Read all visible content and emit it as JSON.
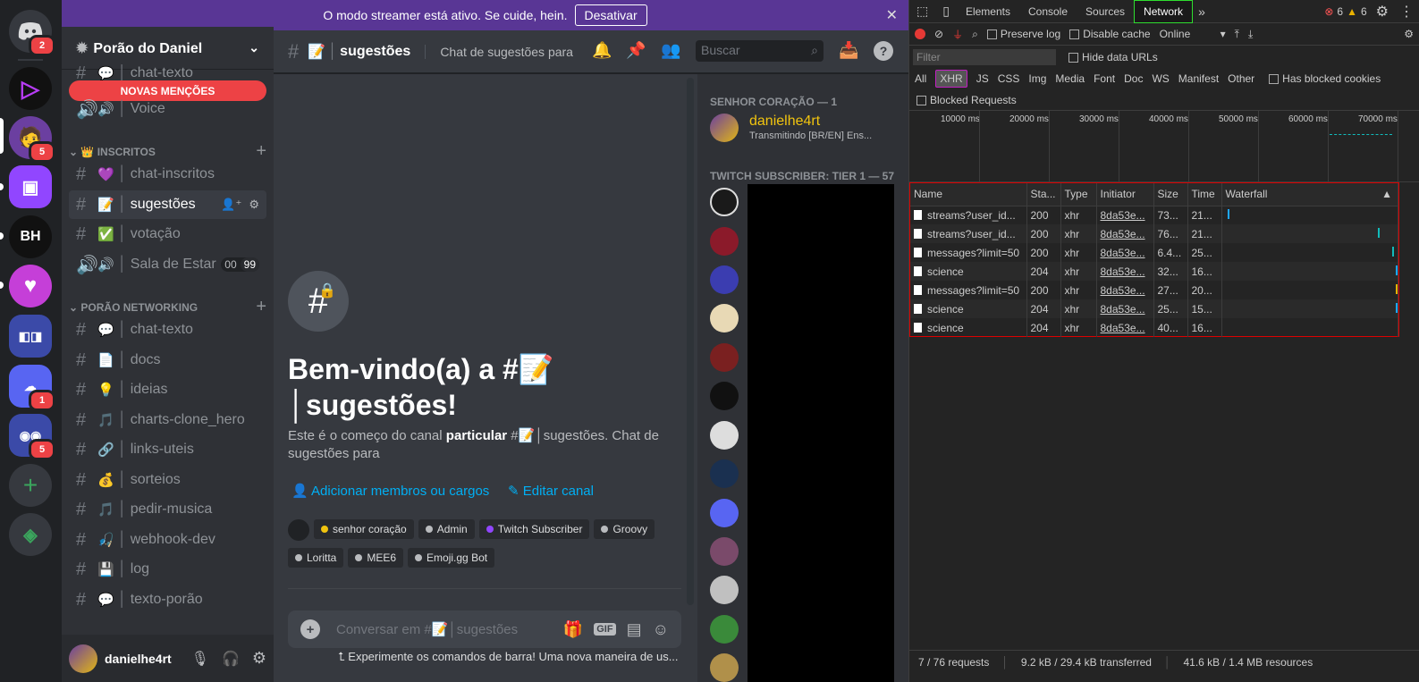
{
  "banner": {
    "text": "O modo streamer está ativo. Se cuide, hein.",
    "button": "Desativar"
  },
  "rail": {
    "badges": [
      "2",
      "5",
      "1",
      "5"
    ],
    "server_initials": "BH"
  },
  "server": {
    "name": "Porão do Daniel",
    "new_mentions": "NOVAS MENÇÕES"
  },
  "channels_top": [
    {
      "name": "chat-texto",
      "emoji": "💬",
      "type": "text"
    },
    {
      "name": "Voice",
      "emoji": "🔊",
      "type": "voice"
    }
  ],
  "category1": {
    "icon": "👑",
    "name": "INSCRITOS"
  },
  "channels_cat1": [
    {
      "emoji": "💜",
      "name": "chat-inscritos",
      "type": "text"
    },
    {
      "emoji": "📝",
      "name": "sugestões",
      "type": "text"
    },
    {
      "emoji": "✅",
      "name": "votação",
      "type": "text"
    },
    {
      "emoji": "🔊",
      "name": "Sala de Estar",
      "type": "voice",
      "count1": "00",
      "count2": "99"
    }
  ],
  "category2": {
    "name": "PORÃO NETWORKING"
  },
  "channels_cat2": [
    {
      "emoji": "💬",
      "name": "chat-texto"
    },
    {
      "emoji": "📄",
      "name": "docs"
    },
    {
      "emoji": "💡",
      "name": "ideias"
    },
    {
      "emoji": "🎵",
      "name": "charts-clone_hero"
    },
    {
      "emoji": "🔗",
      "name": "links-uteis"
    },
    {
      "emoji": "💰",
      "name": "sorteios"
    },
    {
      "emoji": "🎵",
      "name": "pedir-musica"
    },
    {
      "emoji": "🎣",
      "name": "webhook-dev"
    },
    {
      "emoji": "💾",
      "name": "log"
    },
    {
      "emoji": "💬",
      "name": "texto-porão"
    }
  ],
  "user": {
    "name": "danielhe4rt"
  },
  "header": {
    "emoji": "📝",
    "channel": "sugestões",
    "topic": "Chat de sugestões para",
    "search_placeholder": "Buscar"
  },
  "welcome": {
    "title_a": "Bem-vindo(a) a #📝",
    "title_b": "│sugestões!",
    "desc_a": "Este é o começo do canal ",
    "desc_bold": "particular",
    "desc_b": " #📝│sugestões. Chat de sugestões para",
    "add_members": "Adicionar membros ou cargos",
    "edit_channel": "Editar canal"
  },
  "roles": [
    {
      "name": "senhor coração",
      "color": "#f1c40f"
    },
    {
      "name": "Admin",
      "color": "#b9bbbe"
    },
    {
      "name": "Twitch Subscriber",
      "color": "#9146ff"
    },
    {
      "name": "Groovy",
      "color": "#b9bbbe"
    },
    {
      "name": "Loritta",
      "color": "#b9bbbe"
    },
    {
      "name": "MEE6",
      "color": "#b9bbbe"
    },
    {
      "name": "Emoji.gg Bot",
      "color": "#b9bbbe"
    }
  ],
  "composer": {
    "placeholder": "Conversar em #📝│sugestões",
    "gif": "GIF"
  },
  "tip": "⮤ Experimente os comandos de barra! Uma nova maneira de us...",
  "members": {
    "cat1": "SENHOR CORAÇÃO — 1",
    "member1": {
      "name": "danielhe4rt",
      "status": "Transmitindo [BR/EN] Ens..."
    },
    "cat2": "TWITCH SUBSCRIBER: TIER 1 — 57"
  },
  "devtools": {
    "tabs": [
      "Elements",
      "Console",
      "Sources",
      "Network"
    ],
    "selected_tab": "Network",
    "errors": "6",
    "warnings": "6",
    "preserve_log": "Preserve log",
    "disable_cache": "Disable cache",
    "throttle": "Online",
    "filter_placeholder": "Filter",
    "hide_data_urls": "Hide data URLs",
    "types": [
      "All",
      "XHR",
      "JS",
      "CSS",
      "Img",
      "Media",
      "Font",
      "Doc",
      "WS",
      "Manifest",
      "Other"
    ],
    "has_blocked_cookies": "Has blocked cookies",
    "blocked_requests": "Blocked Requests",
    "timeline_labels": [
      "10000 ms",
      "20000 ms",
      "30000 ms",
      "40000 ms",
      "50000 ms",
      "60000 ms",
      "70000 ms"
    ],
    "columns": [
      "Name",
      "Sta...",
      "Type",
      "Initiator",
      "Size",
      "Time",
      "Waterfall"
    ],
    "rows": [
      [
        "streams?user_id...",
        "200",
        "xhr",
        "8da53e...",
        "73...",
        "21..."
      ],
      [
        "streams?user_id...",
        "200",
        "xhr",
        "8da53e...",
        "76...",
        "21..."
      ],
      [
        "messages?limit=50",
        "200",
        "xhr",
        "8da53e...",
        "6.4...",
        "25..."
      ],
      [
        "science",
        "204",
        "xhr",
        "8da53e...",
        "32...",
        "16..."
      ],
      [
        "messages?limit=50",
        "200",
        "xhr",
        "8da53e...",
        "27...",
        "20..."
      ],
      [
        "science",
        "204",
        "xhr",
        "8da53e...",
        "25...",
        "15..."
      ],
      [
        "science",
        "204",
        "xhr",
        "8da53e...",
        "40...",
        "16..."
      ]
    ],
    "summary": [
      "7 / 76 requests",
      "9.2 kB / 29.4 kB transferred",
      "41.6 kB / 1.4 MB resources"
    ]
  }
}
